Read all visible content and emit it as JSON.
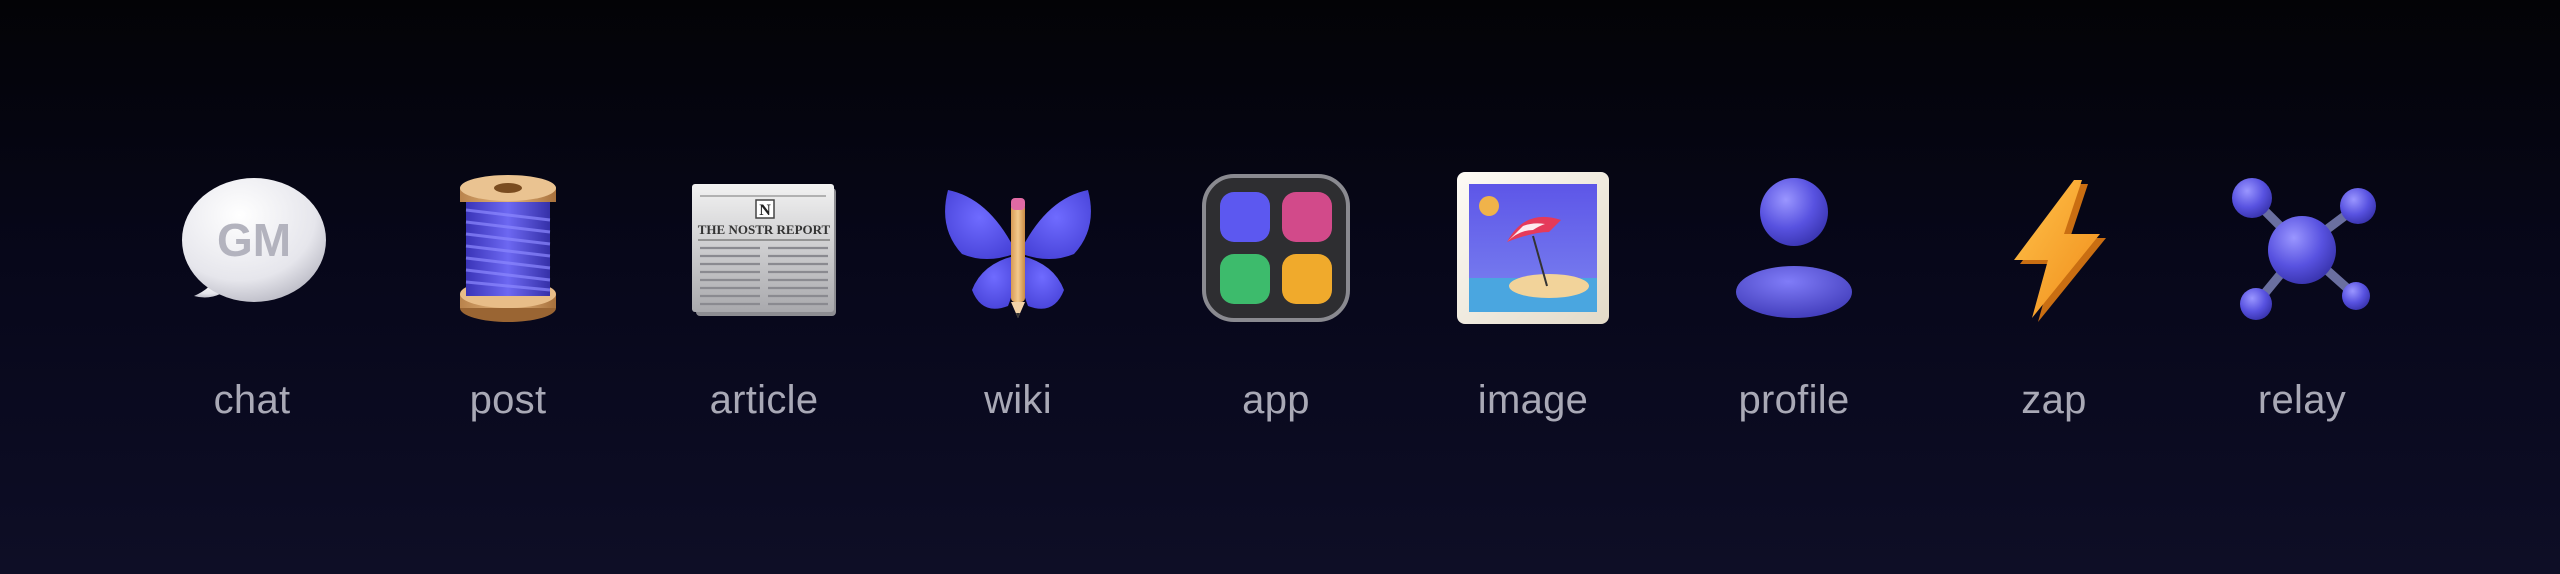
{
  "kinds": [
    {
      "label": "chat",
      "icon": "gm-speech-bubble-icon",
      "bubble_text": "GM"
    },
    {
      "label": "post",
      "icon": "thread-spool-icon"
    },
    {
      "label": "article",
      "icon": "newspaper-icon",
      "masthead_letter": "N",
      "headline": "THE NOSTR REPORT"
    },
    {
      "label": "wiki",
      "icon": "butterfly-pencil-icon"
    },
    {
      "label": "app",
      "icon": "app-grid-icon"
    },
    {
      "label": "image",
      "icon": "framed-beach-picture-icon"
    },
    {
      "label": "profile",
      "icon": "person-silhouette-icon"
    },
    {
      "label": "zap",
      "icon": "lightning-bolt-icon"
    },
    {
      "label": "relay",
      "icon": "network-nodes-icon"
    }
  ],
  "colors": {
    "label_text": "#a9a9b6",
    "accent_purple": "#5a55e0",
    "zap_orange": "#f5a623"
  }
}
